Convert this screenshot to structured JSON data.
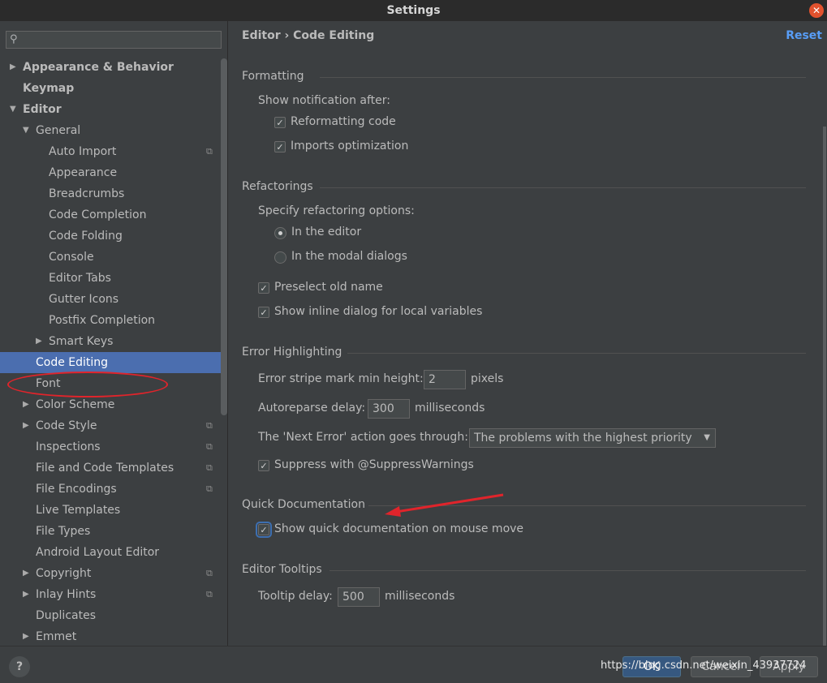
{
  "window": {
    "title": "Settings",
    "close_glyph": "✕"
  },
  "sidebar": {
    "search_placeholder": "",
    "items": [
      {
        "label": "Appearance & Behavior",
        "arrow": "▶",
        "copy": ""
      },
      {
        "label": "Keymap",
        "arrow": "",
        "copy": ""
      },
      {
        "label": "Editor",
        "arrow": "▼",
        "copy": ""
      },
      {
        "label": "General",
        "arrow": "▼",
        "copy": ""
      },
      {
        "label": "Auto Import",
        "arrow": "",
        "copy": "⧉"
      },
      {
        "label": "Appearance",
        "arrow": "",
        "copy": ""
      },
      {
        "label": "Breadcrumbs",
        "arrow": "",
        "copy": ""
      },
      {
        "label": "Code Completion",
        "arrow": "",
        "copy": ""
      },
      {
        "label": "Code Folding",
        "arrow": "",
        "copy": ""
      },
      {
        "label": "Console",
        "arrow": "",
        "copy": ""
      },
      {
        "label": "Editor Tabs",
        "arrow": "",
        "copy": ""
      },
      {
        "label": "Gutter Icons",
        "arrow": "",
        "copy": ""
      },
      {
        "label": "Postfix Completion",
        "arrow": "",
        "copy": ""
      },
      {
        "label": "Smart Keys",
        "arrow": "▶",
        "copy": ""
      },
      {
        "label": "Code Editing",
        "arrow": "",
        "copy": ""
      },
      {
        "label": "Font",
        "arrow": "",
        "copy": ""
      },
      {
        "label": "Color Scheme",
        "arrow": "▶",
        "copy": ""
      },
      {
        "label": "Code Style",
        "arrow": "▶",
        "copy": "⧉"
      },
      {
        "label": "Inspections",
        "arrow": "",
        "copy": "⧉"
      },
      {
        "label": "File and Code Templates",
        "arrow": "",
        "copy": "⧉"
      },
      {
        "label": "File Encodings",
        "arrow": "",
        "copy": "⧉"
      },
      {
        "label": "Live Templates",
        "arrow": "",
        "copy": ""
      },
      {
        "label": "File Types",
        "arrow": "",
        "copy": ""
      },
      {
        "label": "Android Layout Editor",
        "arrow": "",
        "copy": ""
      },
      {
        "label": "Copyright",
        "arrow": "▶",
        "copy": "⧉"
      },
      {
        "label": "Inlay Hints",
        "arrow": "▶",
        "copy": "⧉"
      },
      {
        "label": "Duplicates",
        "arrow": "",
        "copy": ""
      },
      {
        "label": "Emmet",
        "arrow": "▶",
        "copy": ""
      }
    ]
  },
  "header": {
    "breadcrumb": "Editor  ›  Code Editing",
    "reset": "Reset"
  },
  "formatting": {
    "title": "Formatting",
    "notify_label": "Show notification after:",
    "reformat": "Reformatting code",
    "imports": "Imports optimization"
  },
  "refactorings": {
    "title": "Refactorings",
    "specify_label": "Specify refactoring options:",
    "in_editor": "In the editor",
    "in_modal": "In the modal dialogs",
    "preselect": "Preselect old name",
    "inline_dialog": "Show inline dialog for local variables"
  },
  "errors": {
    "title": "Error Highlighting",
    "stripe_label": "Error stripe mark min height:",
    "stripe_value": "2",
    "stripe_unit": "pixels",
    "reparse_label": "Autoreparse delay:",
    "reparse_value": "300",
    "reparse_unit": "milliseconds",
    "next_error_label": "The 'Next Error' action goes through:",
    "next_error_value": "The problems with the highest priority",
    "suppress": "Suppress with @SuppressWarnings"
  },
  "quickdoc": {
    "title": "Quick Documentation",
    "show_on_move": "Show quick documentation on mouse move"
  },
  "tooltips": {
    "title": "Editor Tooltips",
    "delay_label": "Tooltip delay:",
    "delay_value": "500",
    "delay_unit": "milliseconds"
  },
  "footer": {
    "help": "?",
    "ok": "OK",
    "cancel": "Cancel",
    "apply": "Apply",
    "watermark": "https://blog.csdn.net/weixin_43937724"
  },
  "glyphs": {
    "check": "✓",
    "caret": "▼",
    "search": "⚲"
  },
  "colors": {
    "selection": "#4b6eaf",
    "link": "#589df6",
    "annotation": "#e0242b"
  }
}
